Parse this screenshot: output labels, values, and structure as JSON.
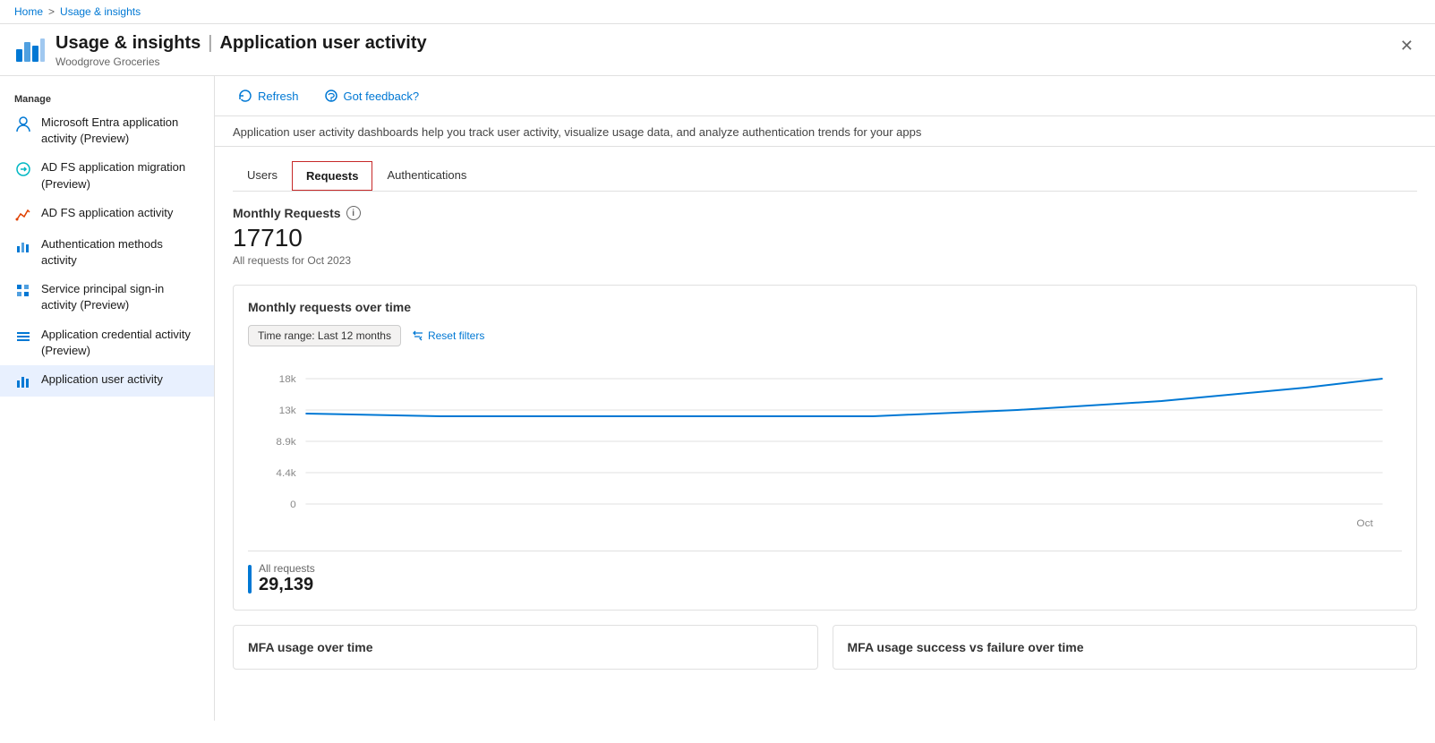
{
  "breadcrumb": {
    "home": "Home",
    "separator": ">",
    "current": "Usage & insights"
  },
  "header": {
    "title": "Usage & insights",
    "separator": "|",
    "subtitle": "Application user activity",
    "org": "Woodgrove Groceries"
  },
  "toolbar": {
    "refresh_label": "Refresh",
    "feedback_label": "Got feedback?"
  },
  "description": "Application user activity dashboards help you track user activity, visualize usage data, and analyze authentication trends for your apps",
  "tabs": [
    {
      "id": "users",
      "label": "Users"
    },
    {
      "id": "requests",
      "label": "Requests"
    },
    {
      "id": "authentications",
      "label": "Authentications"
    }
  ],
  "active_tab": "requests",
  "stats": {
    "monthly_requests_label": "Monthly Requests",
    "value": "17710",
    "description": "All requests for Oct 2023"
  },
  "chart": {
    "title": "Monthly requests over time",
    "time_range_label": "Time range: Last 12 months",
    "reset_filters_label": "Reset filters",
    "y_axis": [
      "18k",
      "13k",
      "8.9k",
      "4.4k",
      "0"
    ],
    "x_axis_label": "Oct"
  },
  "legend": {
    "label": "All requests",
    "value": "29,139"
  },
  "bottom_panels": [
    {
      "id": "mfa-usage",
      "title": "MFA usage over time"
    },
    {
      "id": "mfa-success-failure",
      "title": "MFA usage success vs failure over time"
    }
  ],
  "sidebar": {
    "manage_label": "Manage",
    "items": [
      {
        "id": "ms-entra",
        "label": "Microsoft Entra application activity (Preview)",
        "icon": "person-icon"
      },
      {
        "id": "adfs-migration",
        "label": "AD FS application migration (Preview)",
        "icon": "adfs-migrate-icon"
      },
      {
        "id": "adfs-activity",
        "label": "AD FS application activity",
        "icon": "adfs-activity-icon"
      },
      {
        "id": "auth-methods",
        "label": "Authentication methods activity",
        "icon": "chart-icon"
      },
      {
        "id": "service-principal",
        "label": "Service principal sign-in activity (Preview)",
        "icon": "grid-icon"
      },
      {
        "id": "app-credential",
        "label": "Application credential activity (Preview)",
        "icon": "lines-icon"
      },
      {
        "id": "app-user",
        "label": "Application user activity",
        "icon": "chart-bar-icon",
        "active": true
      }
    ]
  }
}
